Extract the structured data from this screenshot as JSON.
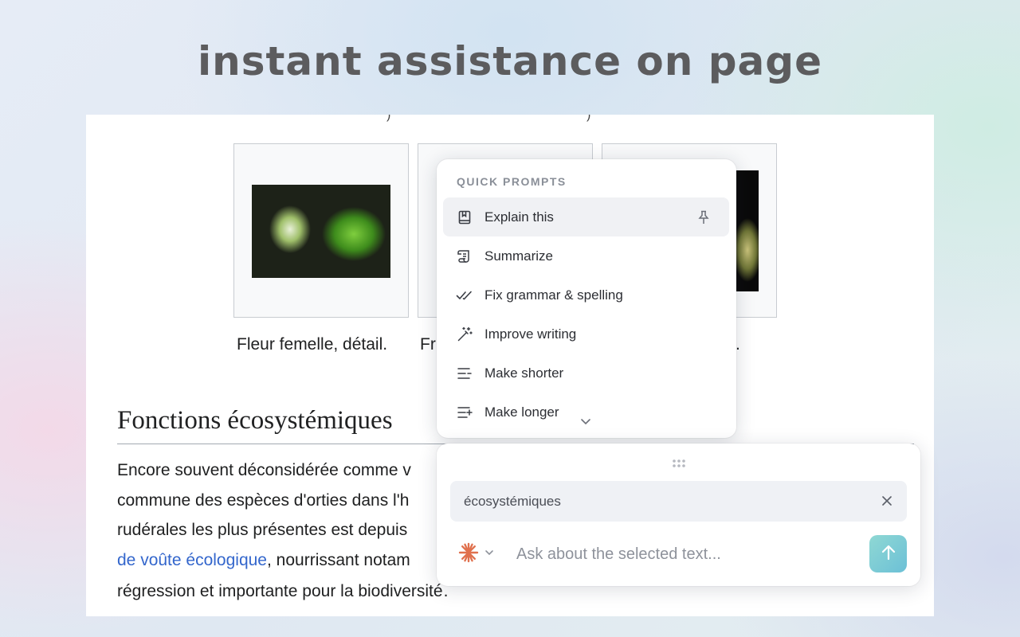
{
  "headline": "instant assistance on page",
  "article": {
    "captions": [
      "Fleur femelle, détail.",
      "Fr",
      "."
    ],
    "section_heading": "Fonctions écosystémiques",
    "paragraph": {
      "line1": "Encore souvent déconsidérée comme v",
      "line2": "commune des espèces d'orties dans l'h",
      "line3": "rudérales les plus présentes est depuis",
      "line4_link": "de voûte écologique",
      "line4_rest": ", nourrissant notam",
      "line5": "régression et importante pour la biodiversité"
    }
  },
  "quick_prompts": {
    "title": "QUICK PROMPTS",
    "items": [
      {
        "label": "Explain this",
        "icon": "book-icon"
      },
      {
        "label": "Summarize",
        "icon": "scroll-icon"
      },
      {
        "label": "Fix grammar & spelling",
        "icon": "double-check-icon"
      },
      {
        "label": "Improve writing",
        "icon": "magic-wand-icon"
      },
      {
        "label": "Make shorter",
        "icon": "text-shorter-icon"
      },
      {
        "label": "Make longer",
        "icon": "text-longer-icon"
      }
    ]
  },
  "chat": {
    "selected_text": "écosystémiques",
    "input_placeholder": "Ask about the selected text...",
    "model_icon": "claude-asterisk-icon",
    "accent_color": "#e0714e",
    "send_color": "#7fcfd6"
  }
}
